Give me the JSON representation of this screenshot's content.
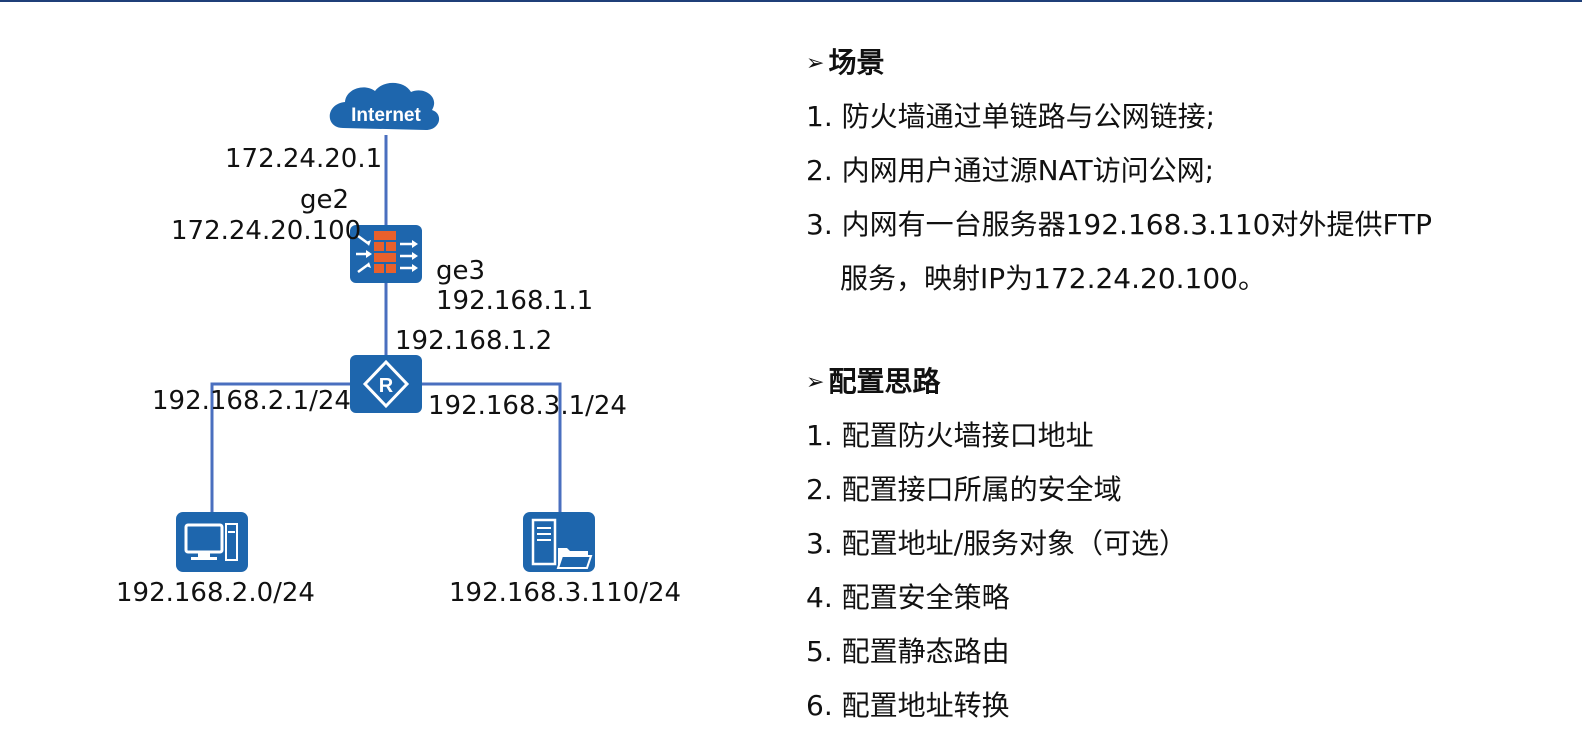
{
  "colors": {
    "link": "#4a6fbf",
    "device": "#1e66ad",
    "firewall_bricks": "#e8602c",
    "top_rule": "#1f3f78"
  },
  "topology": {
    "cloud": {
      "label": "Internet",
      "icon": "cloud-icon"
    },
    "internet_side_ip": "172.24.20.1",
    "firewall": {
      "icon": "firewall-icon",
      "upstream_interface": "ge2",
      "upstream_ip": "172.24.20.100",
      "downstream_interface": "ge3",
      "downstream_ip": "192.168.1.1"
    },
    "router": {
      "icon": "router-icon",
      "uplink_ip": "192.168.1.2",
      "left_ip": "192.168.2.1/24",
      "right_ip": "192.168.3.1/24"
    },
    "pc": {
      "icon": "pc-icon",
      "subnet": "192.168.2.0/24"
    },
    "server": {
      "icon": "server-icon",
      "subnet": "192.168.3.110/24"
    }
  },
  "scenario": {
    "heading": "场景",
    "items": [
      "1. 防火墙通过单链路与公网链接;",
      "2. 内网用户通过源NAT访问公网;",
      "3. 内网有一台服务器192.168.3.110对外提供FTP",
      "服务，映射IP为172.24.20.100。"
    ]
  },
  "config": {
    "heading": "配置思路",
    "items": [
      "1. 配置防火墙接口地址",
      "2. 配置接口所属的安全域",
      "3. 配置地址/服务对象（可选）",
      "4. 配置安全策略",
      "5. 配置静态路由",
      "6. 配置地址转换"
    ]
  }
}
